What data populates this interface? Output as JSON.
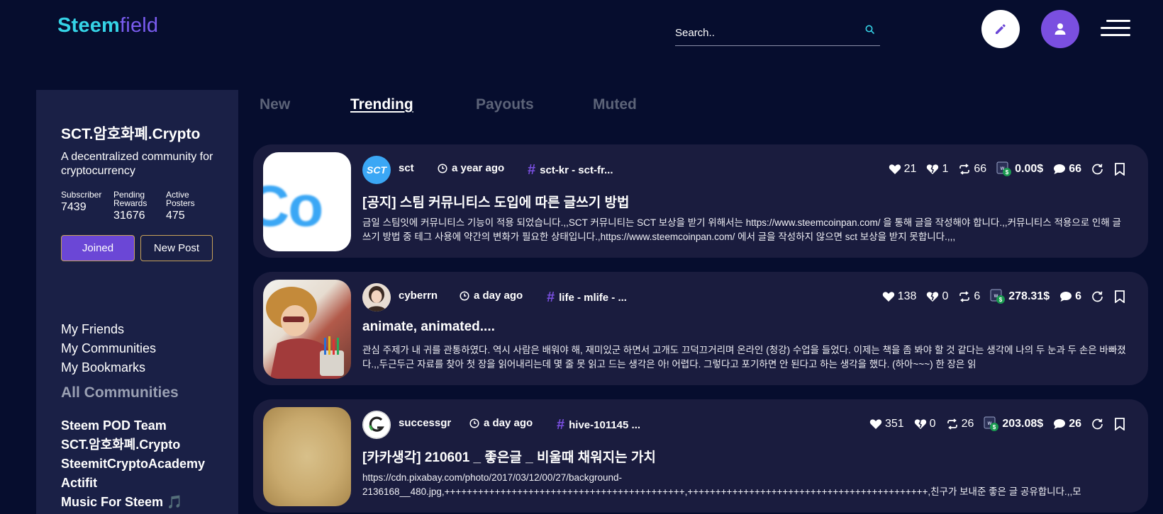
{
  "brand": {
    "part1": "Steem",
    "part2": "field"
  },
  "search": {
    "placeholder": "Search.."
  },
  "sidebar": {
    "title": "SCT.암호화폐.Crypto",
    "description": "A decentralized community for cryptocurrency",
    "stats": [
      {
        "label1": "Subscriber",
        "label2": "",
        "value": "7439"
      },
      {
        "label1": "Pending",
        "label2": "Rewards",
        "value": "31676"
      },
      {
        "label1": "Active",
        "label2": "Posters",
        "value": "475"
      }
    ],
    "joined_label": "Joined",
    "new_post_label": "New Post",
    "links": [
      "My Friends",
      "My Communities",
      "My Bookmarks"
    ],
    "all_communities_label": "All Communities",
    "communities": [
      "Steem POD Team",
      "SCT.암호화폐.Crypto",
      "SteemitCryptoAcademy",
      "Actifit",
      "Music For Steem 🎵"
    ]
  },
  "tabs": [
    {
      "label": "New",
      "active": false
    },
    {
      "label": "Trending",
      "active": true
    },
    {
      "label": "Payouts",
      "active": false
    },
    {
      "label": "Muted",
      "active": false
    }
  ],
  "posts": [
    {
      "author": "sct",
      "time": "a year ago",
      "tags": "sct-kr - sct-fr...",
      "title": "[공지] 스팀 커뮤니티스 도입에 따른 글쓰기 방법",
      "body": "금일 스팀잇에 커뮤니티스 기능이 적용 되었습니다.,,SCT 커뮤니티는 SCT 보상을 받기 위해서는 https://www.steemcoinpan.com/ 을 통해 글을 작성해야 합니다.,,커뮤니티스 적용으로 인해 글쓰기 방법 중 테그 사용에 약간의 변화가 필요한 상태입니다.,https://www.steemcoinpan.com/ 에서 글을 작성하지 않으면 sct 보상을 받지 못합니다.,,,",
      "likes": "21",
      "dislikes": "1",
      "resteems": "66",
      "payout": "0.00$",
      "comments": "66",
      "thumb_text": "Co",
      "avatar_text": "SCT"
    },
    {
      "author": "cyberrn",
      "time": "a day ago",
      "tags": "life - mlife - ...",
      "title": "animate, animated....",
      "body": "관심 주제가 내 귀를 관통하였다. 역시 사람은 배워야 해, 재미있군 하면서 고개도 끄덕끄거리며 온라인 (청강) 수업을 들었다. 이제는 책을 좀 봐야 할 것 같다는 생각에 나의 두 눈과 두 손은 바빠졌다.,,두근두근 자료를 찾아 첫 장을 읽어내리는데 몇 줄 못 읽고 드는 생각은 아! 어렵다. 그렇다고 포기하면 안 된다고 하는 생각을 했다. (하아~~~) 한 장은 읽",
      "likes": "138",
      "dislikes": "0",
      "resteems": "6",
      "payout": "278.31$",
      "comments": "6"
    },
    {
      "author": "successgr",
      "time": "a day ago",
      "tags": "hive-101145 ...",
      "title": "[카카생각] 210601 _ 좋은글 _ 비울때 채워지는 가치",
      "body": "https://cdn.pixabay.com/photo/2017/03/12/00/27/background-\n2136168__480.jpg,+++++++++++++++++++++++++++++++++++++++++++,+++++++++++++++++++++++++++++++++++++++++++,친구가 보내준 좋은 글 공유합니다.,,모",
      "likes": "351",
      "dislikes": "0",
      "resteems": "26",
      "payout": "203.08$",
      "comments": "26"
    }
  ],
  "colors": {
    "background": "#060d2e",
    "sidebar": "#1a2046",
    "card": "#1a1c3e",
    "accent_purple": "#7a4fe0",
    "brand_cyan": "#35d3e6"
  }
}
